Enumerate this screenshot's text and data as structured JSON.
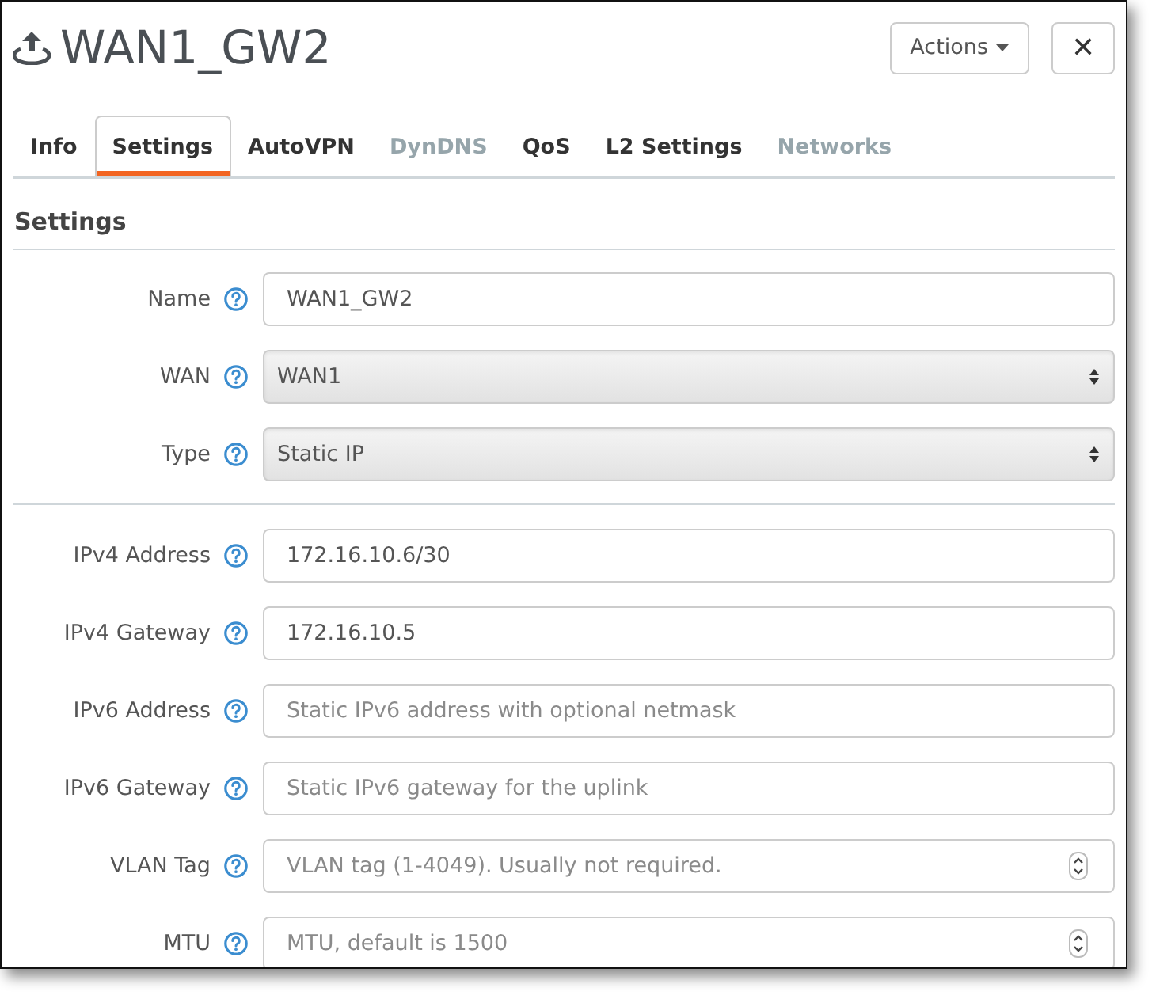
{
  "header": {
    "title": "WAN1_GW2",
    "actions_button": "Actions",
    "close_button": "✕"
  },
  "tabs": [
    {
      "label": "Info",
      "selected": false,
      "disabled": false
    },
    {
      "label": "Settings",
      "selected": true,
      "disabled": false
    },
    {
      "label": "AutoVPN",
      "selected": false,
      "disabled": false
    },
    {
      "label": "DynDNS",
      "selected": false,
      "disabled": true
    },
    {
      "label": "QoS",
      "selected": false,
      "disabled": false
    },
    {
      "label": "L2 Settings",
      "selected": false,
      "disabled": false
    },
    {
      "label": "Networks",
      "selected": false,
      "disabled": true
    }
  ],
  "section_title": "Settings",
  "field_groups": [
    {
      "fields": [
        {
          "label": "Name",
          "kind": "text",
          "value": "WAN1_GW2"
        },
        {
          "label": "WAN",
          "kind": "select",
          "value": "WAN1"
        },
        {
          "label": "Type",
          "kind": "select",
          "value": "Static IP"
        }
      ]
    },
    {
      "fields": [
        {
          "label": "IPv4 Address",
          "kind": "text",
          "value": "172.16.10.6/30"
        },
        {
          "label": "IPv4 Gateway",
          "kind": "text",
          "value": "172.16.10.5"
        },
        {
          "label": "IPv6 Address",
          "kind": "text",
          "placeholder": "Static IPv6 address with optional netmask"
        },
        {
          "label": "IPv6 Gateway",
          "kind": "text",
          "placeholder": "Static IPv6 gateway for the uplink"
        },
        {
          "label": "VLAN Tag",
          "kind": "number",
          "placeholder": "VLAN tag (1-4049). Usually not required."
        },
        {
          "label": "MTU",
          "kind": "number",
          "placeholder": "MTU, default is 1500"
        }
      ]
    }
  ]
}
